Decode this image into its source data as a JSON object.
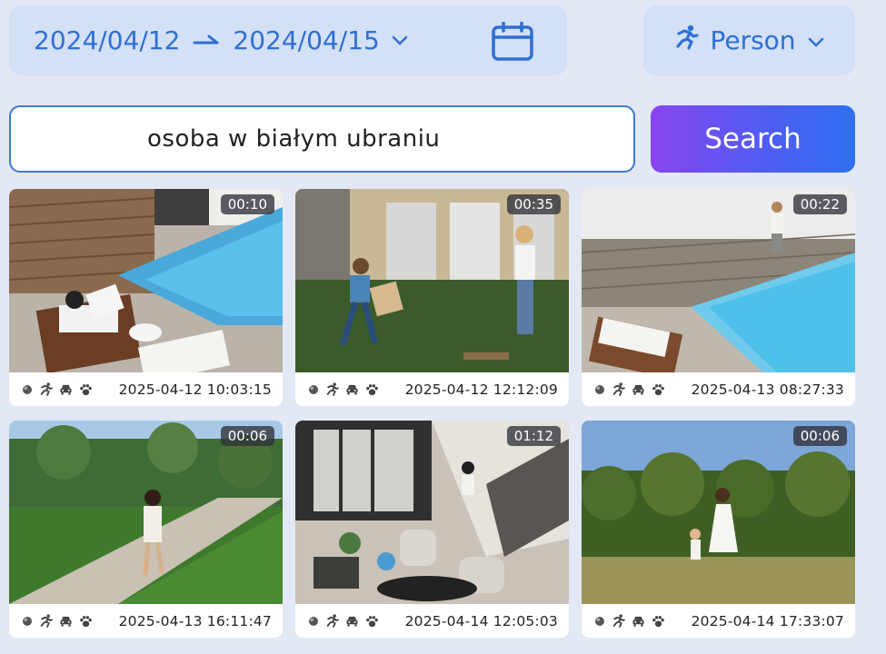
{
  "filters": {
    "date_start": "2024/04/12",
    "date_end": "2024/04/15",
    "person_label": "Person"
  },
  "search": {
    "query": "osoba w białym ubraniu",
    "button_label": "Search"
  },
  "videos": [
    {
      "duration": "00:10",
      "timestamp": "2025-04-12 10:03:15",
      "scene": "pool-lounger"
    },
    {
      "duration": "00:35",
      "timestamp": "2025-04-12 12:12:09",
      "scene": "lawn-play"
    },
    {
      "duration": "00:22",
      "timestamp": "2025-04-13 08:27:33",
      "scene": "pool-walk"
    },
    {
      "duration": "00:06",
      "timestamp": "2025-04-13 16:11:47",
      "scene": "garden-path"
    },
    {
      "duration": "01:12",
      "timestamp": "2025-04-14 12:05:03",
      "scene": "loft-interior"
    },
    {
      "duration": "00:06",
      "timestamp": "2025-04-14 17:33:07",
      "scene": "meadow-run"
    }
  ],
  "card_icons": [
    "dot-icon",
    "motion-icon",
    "car-icon",
    "paw-icon"
  ],
  "colors": {
    "background": "#e3e8f5",
    "accent": "#2f6fd4",
    "filter_bg": "#d3e0f6",
    "search_gradient_start": "#8a45f0",
    "search_gradient_end": "#2f6ff0"
  }
}
